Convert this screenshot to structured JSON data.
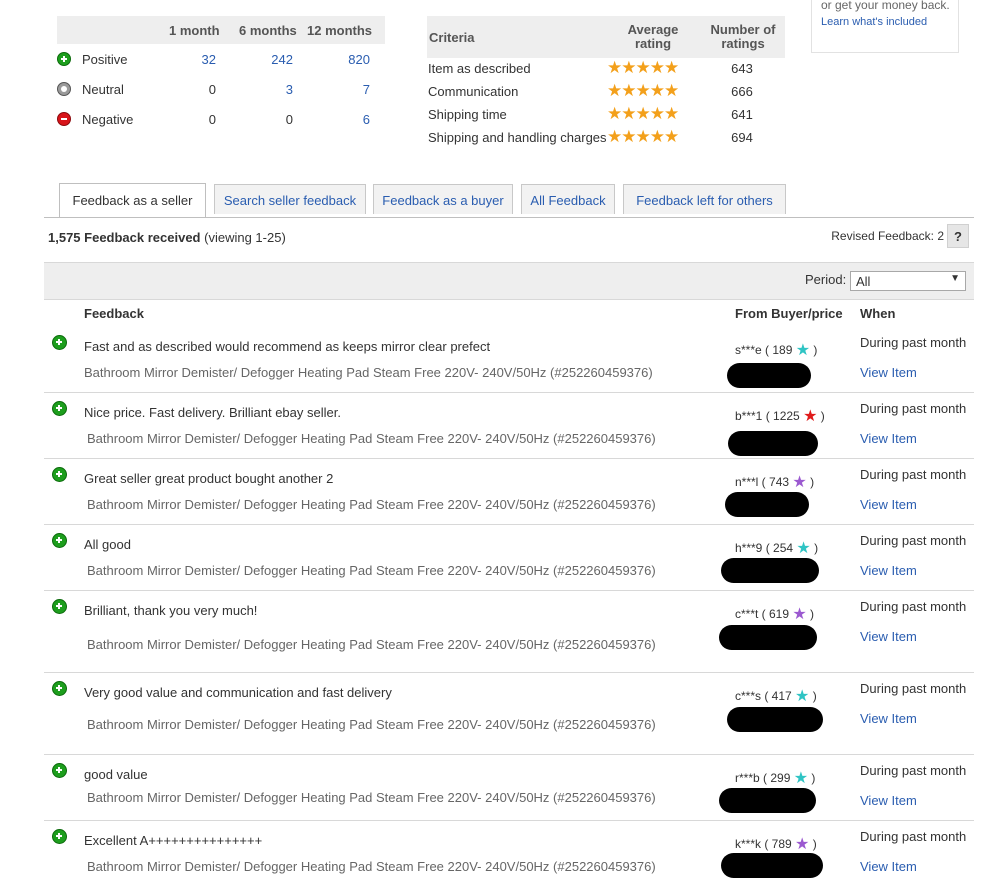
{
  "ratings": {
    "headers": [
      "1 month",
      "6 months",
      "12 months"
    ],
    "rows": [
      {
        "label": "Positive",
        "type": "positive",
        "values": [
          "32",
          "242",
          "820"
        ]
      },
      {
        "label": "Neutral",
        "type": "neutral",
        "values": [
          "0",
          "3",
          "7"
        ]
      },
      {
        "label": "Negative",
        "type": "negative",
        "values": [
          "0",
          "0",
          "6"
        ]
      }
    ]
  },
  "dsr": {
    "col_criteria": "Criteria",
    "col_avg_1": "Average",
    "col_avg_2": "rating",
    "col_count_1": "Number of",
    "col_count_2": "ratings",
    "rows": [
      {
        "name": "Item as described",
        "stars": 5,
        "count": "643"
      },
      {
        "name": "Communication",
        "stars": 5,
        "count": "666"
      },
      {
        "name": "Shipping time",
        "stars": 5,
        "count": "641"
      },
      {
        "name": "Shipping and handling charges",
        "stars": 5,
        "count": "694"
      }
    ]
  },
  "money_back": {
    "line1": "or get your money back.",
    "link": "Learn what's included"
  },
  "tabs": [
    "Feedback as a seller",
    "Search seller feedback",
    "Feedback as a buyer",
    "All Feedback",
    "Feedback left for others"
  ],
  "summary": {
    "count": "1,575 Feedback received",
    "viewing": "(viewing 1-25)",
    "revised": "Revised Feedback: 2",
    "help": "?"
  },
  "period": {
    "label": "Period:",
    "selected": "All"
  },
  "columns": {
    "feedback": "Feedback",
    "buyer": "From Buyer/price",
    "when": "When"
  },
  "feedback": [
    {
      "comment": "Fast and as described would recommend as keeps mirror clear prefect",
      "item": "Bathroom Mirror Demister/ Defogger Heating Pad Steam Free 220V- 240V/50Hz (#252260459376)",
      "buyer": "s***e ( 189",
      "star_color": "#2fc4c4",
      "when": "During past month",
      "view": "View Item"
    },
    {
      "comment": "Nice price. Fast delivery. Brilliant ebay seller.",
      "item": "Bathroom Mirror Demister/ Defogger Heating Pad Steam Free 220V- 240V/50Hz (#252260459376)",
      "buyer": "b***1 ( 1225",
      "star_color": "#e01b1b",
      "when": "During past month",
      "view": "View Item"
    },
    {
      "comment": "Great seller great product bought another 2",
      "item": "Bathroom Mirror Demister/ Defogger Heating Pad Steam Free 220V- 240V/50Hz (#252260459376)",
      "buyer": "n***l ( 743",
      "star_color": "#9b59d0",
      "when": "During past month",
      "view": "View Item"
    },
    {
      "comment": "All good",
      "item": "Bathroom Mirror Demister/ Defogger Heating Pad Steam Free 220V- 240V/50Hz (#252260459376)",
      "buyer": "h***9 ( 254",
      "star_color": "#2fc4c4",
      "when": "During past month",
      "view": "View Item"
    },
    {
      "comment": "Brilliant, thank you very much!",
      "item": "Bathroom Mirror Demister/ Defogger Heating Pad Steam Free 220V- 240V/50Hz (#252260459376)",
      "buyer": "c***t ( 619",
      "star_color": "#9b59d0",
      "when": "During past month",
      "view": "View Item"
    },
    {
      "comment": "Very good value and communication and fast delivery",
      "item": "Bathroom Mirror Demister/ Defogger Heating Pad Steam Free 220V- 240V/50Hz (#252260459376)",
      "buyer": "c***s ( 417",
      "star_color": "#2fc4c4",
      "when": "During past month",
      "view": "View Item"
    },
    {
      "comment": "good value",
      "item": "Bathroom Mirror Demister/ Defogger Heating Pad Steam Free 220V- 240V/50Hz (#252260459376)",
      "buyer": "r***b ( 299",
      "star_color": "#2fc4c4",
      "when": "During past month",
      "view": "View Item"
    },
    {
      "comment": "Excellent A+++++++++++++++",
      "item": "Bathroom Mirror Demister/ Defogger Heating Pad Steam Free 220V- 240V/50Hz (#252260459376)",
      "buyer": "k***k ( 789",
      "star_color": "#9b59d0",
      "when": "During past month",
      "view": "View Item"
    }
  ]
}
